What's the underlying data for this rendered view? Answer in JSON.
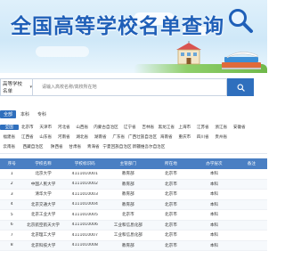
{
  "banner": {
    "title": "全国高等学校名单查询",
    "colors": {
      "title": "#1f5fb8",
      "sky": "#dff0fb"
    }
  },
  "search": {
    "category": "高等学校名单",
    "placeholder": "请输入高校名称/高校所在地",
    "button_icon": "search-icon",
    "accent": "#2f6fbd"
  },
  "type_tabs": [
    {
      "label": "全部",
      "active": true
    },
    {
      "label": "本科",
      "active": false
    },
    {
      "label": "专科",
      "active": false
    }
  ],
  "provinces": [
    [
      "全国",
      "北京市",
      "天津市",
      "河北省",
      "山西省",
      "内蒙古自治区",
      "辽宁省",
      "吉林省",
      "黑龙江省",
      "上海市",
      "江苏省",
      "浙江省",
      "安徽省"
    ],
    [
      "福建省",
      "江西省",
      "山东省",
      "河南省",
      "湖北省",
      "湖南省",
      "广东省",
      "广西壮族自治区",
      "海南省",
      "重庆市",
      "四川省",
      "贵州省"
    ],
    [
      "云南省",
      "西藏自治区",
      "陕西省",
      "甘肃省",
      "青海省",
      "宁夏回族自治区",
      "新疆维吾尔自治区"
    ]
  ],
  "table": {
    "headers": [
      "序号",
      "学校名称",
      "学校标识码",
      "主管部门",
      "所在地",
      "办学层次",
      "备注"
    ],
    "rows": [
      [
        "1",
        "北京大学",
        "4111010001",
        "教育部",
        "北京市",
        "本科",
        ""
      ],
      [
        "2",
        "中国人民大学",
        "4111010002",
        "教育部",
        "北京市",
        "本科",
        ""
      ],
      [
        "3",
        "清华大学",
        "4111010003",
        "教育部",
        "北京市",
        "本科",
        ""
      ],
      [
        "4",
        "北京交通大学",
        "4111010004",
        "教育部",
        "北京市",
        "本科",
        ""
      ],
      [
        "5",
        "北京工业大学",
        "4111010005",
        "北京市",
        "北京市",
        "本科",
        ""
      ],
      [
        "6",
        "北京航空航天大学",
        "4111010006",
        "工业和信息化部",
        "北京市",
        "本科",
        ""
      ],
      [
        "7",
        "北京理工大学",
        "4111010007",
        "工业和信息化部",
        "北京市",
        "本科",
        ""
      ],
      [
        "8",
        "北京科技大学",
        "4111010008",
        "教育部",
        "北京市",
        "本科",
        ""
      ]
    ],
    "header_color": "#4a7fc3"
  }
}
